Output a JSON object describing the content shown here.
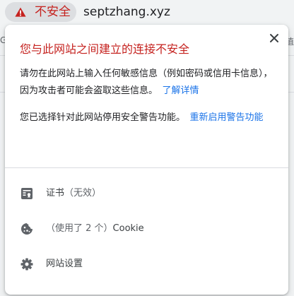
{
  "omnibox": {
    "security_label": "不安全",
    "url": "septzhang.xyz",
    "warning_color": "#c5221f"
  },
  "background_page": {
    "left_fragment": "G",
    "right_fragment": "值"
  },
  "popup": {
    "title": "您与此网站之间建立的连接不安全",
    "paragraph1": {
      "text": "请勿在此网站上输入任何敏感信息（例如密码或信用卡信息），因为攻击者可能会盗取这些信息。",
      "link": "了解详情"
    },
    "paragraph2": {
      "text": "您已选择针对此网站停用安全警告功能。",
      "link": "重新启用警告功能"
    },
    "close_icon": "close-icon",
    "link_color": "#1a73e8"
  },
  "menu": {
    "certificate": {
      "label": "证书",
      "status": "（无效）",
      "icon": "certificate-icon"
    },
    "cookies": {
      "prefix": "（使用了 2 个）",
      "label": "Cookie",
      "icon": "cookie-icon"
    },
    "site_settings": {
      "label": "网站设置",
      "icon": "gear-icon"
    }
  }
}
